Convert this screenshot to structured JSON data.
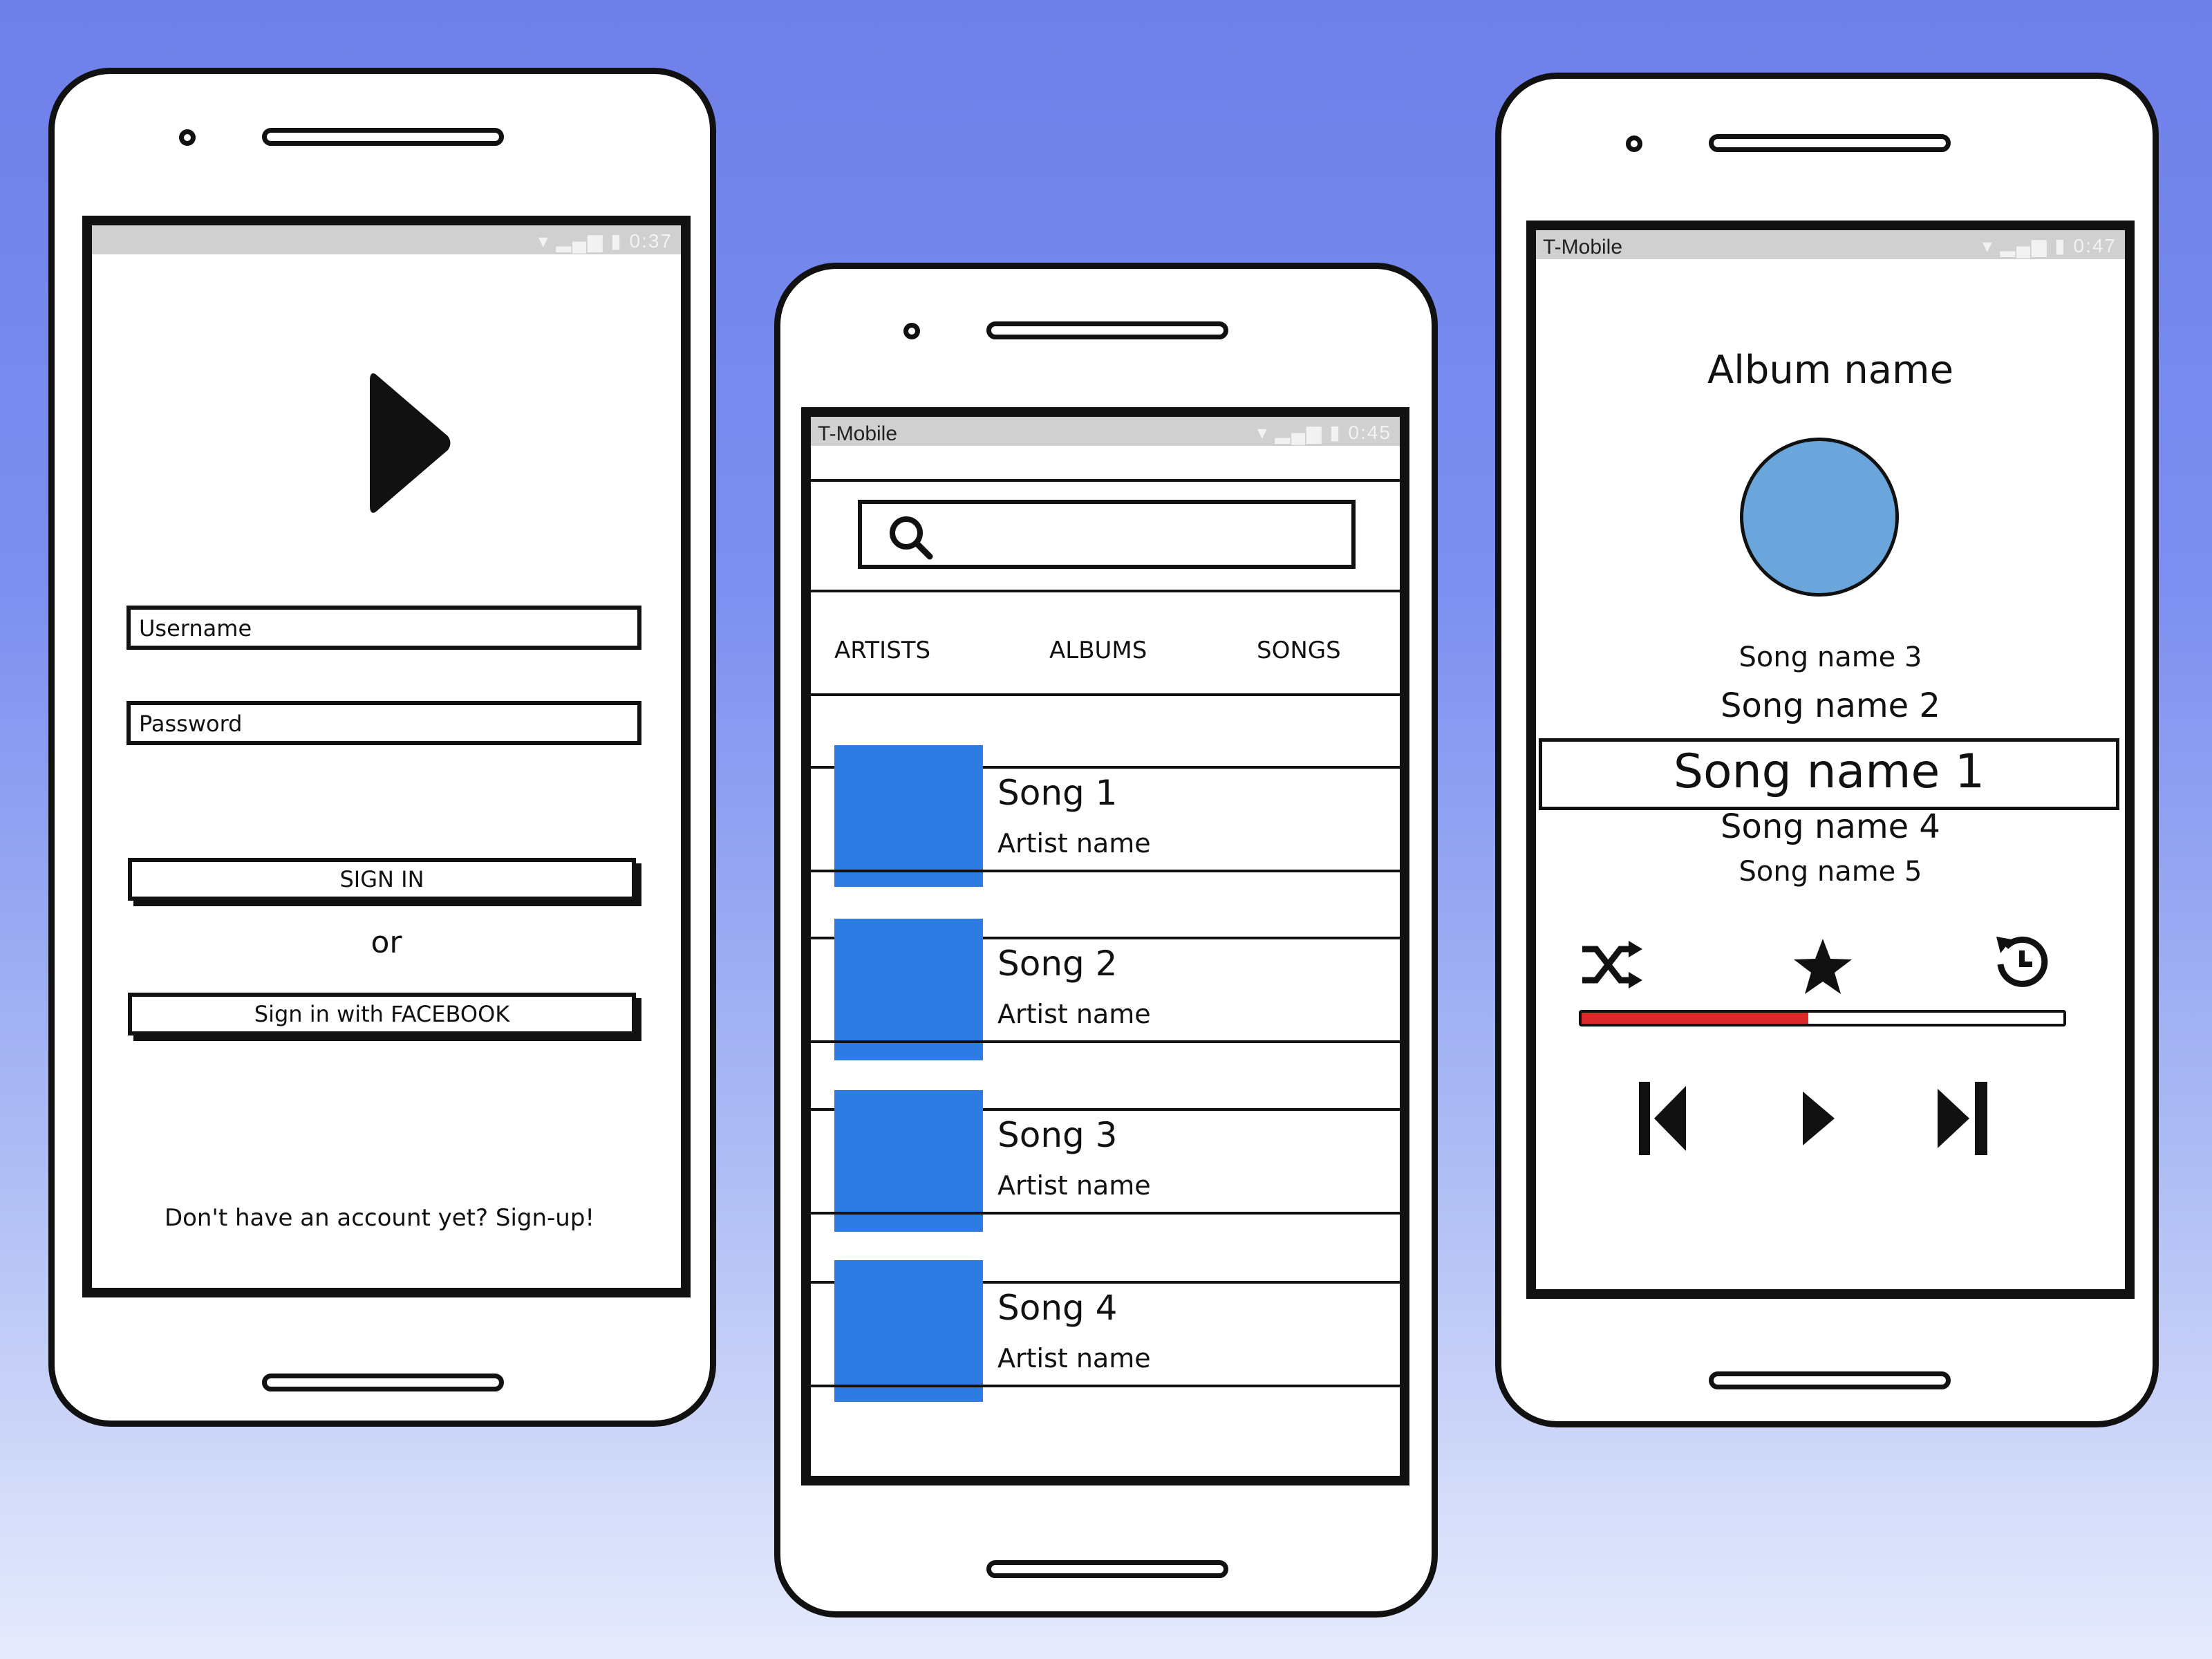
{
  "colors": {
    "accent_blue": "#2d7be3",
    "album_art": "#6aa5dc",
    "progress_fill": "#d92a2a"
  },
  "login": {
    "status_time": "0:37",
    "logo_icon": "play-triangle-icon",
    "username_placeholder": "Username",
    "password_placeholder": "Password",
    "sign_in_label": "SIGN IN",
    "or_label": "or",
    "facebook_label": "Sign in with FACEBOOK",
    "signup_text": "Don't have an account yet? Sign-up!"
  },
  "library": {
    "carrier": "T-Mobile",
    "status_time": "0:45",
    "search_icon": "search-icon",
    "tabs": [
      "ARTISTS",
      "ALBUMS",
      "SONGS"
    ],
    "songs": [
      {
        "title": "Song 1",
        "artist": "Artist name"
      },
      {
        "title": "Song 2",
        "artist": "Artist name"
      },
      {
        "title": "Song 3",
        "artist": "Artist name"
      },
      {
        "title": "Song 4",
        "artist": "Artist name"
      }
    ]
  },
  "player": {
    "carrier": "T-Mobile",
    "status_time": "0:47",
    "album_name": "Album name",
    "queue": {
      "song3": "Song name 3",
      "song2": "Song name 2",
      "current": "Song name 1",
      "song4": "Song name 4",
      "song5": "Song name 5"
    },
    "progress": 0.47,
    "icons": [
      "shuffle-icon",
      "star-icon",
      "replay-icon",
      "previous-icon",
      "play-icon",
      "next-icon"
    ]
  }
}
